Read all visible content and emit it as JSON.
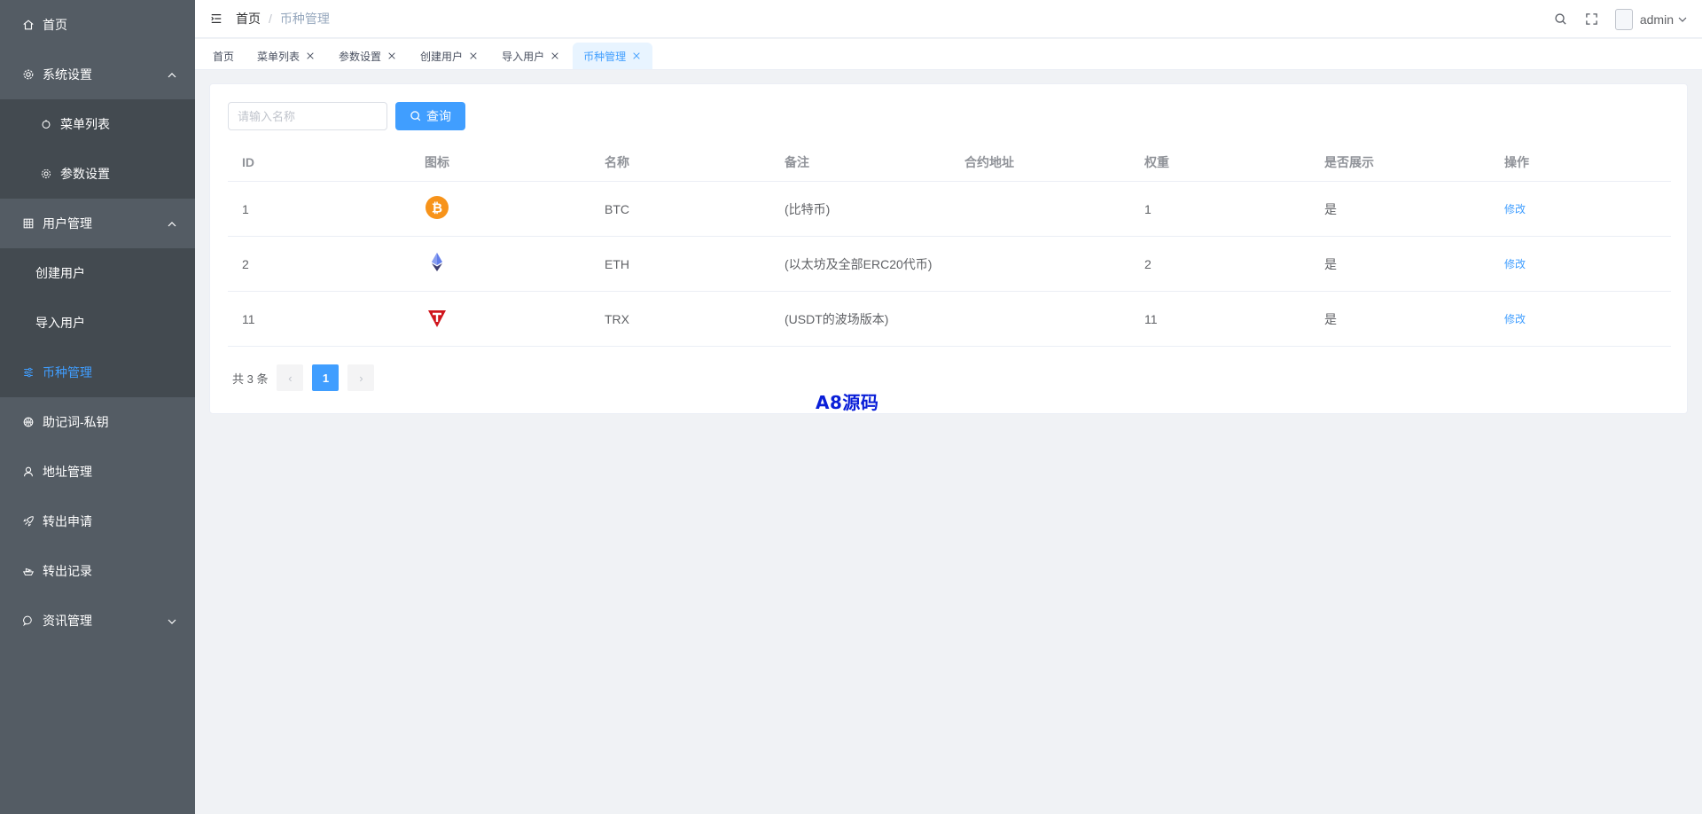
{
  "sidebar": {
    "items": [
      {
        "label": "首页",
        "icon": "home-icon"
      },
      {
        "label": "系统设置",
        "icon": "gear-icon"
      },
      {
        "label": "菜单列表",
        "icon": "menu-list-icon"
      },
      {
        "label": "参数设置",
        "icon": "settings-icon"
      },
      {
        "label": "用户管理",
        "icon": "user-manage-icon"
      },
      {
        "label": "创建用户"
      },
      {
        "label": "导入用户"
      },
      {
        "label": "币种管理",
        "icon": "sliders-icon",
        "active": true
      },
      {
        "label": "助记词-私钥",
        "icon": "basketball-icon"
      },
      {
        "label": "地址管理",
        "icon": "user-icon"
      },
      {
        "label": "转出申请",
        "icon": "rocket-icon"
      },
      {
        "label": "转出记录",
        "icon": "ship-icon"
      },
      {
        "label": "资讯管理",
        "icon": "chat-icon"
      }
    ]
  },
  "header": {
    "breadcrumb_home": "首页",
    "breadcrumb_sep": "/",
    "breadcrumb_current": "币种管理",
    "user_name": "admin"
  },
  "tags": [
    {
      "label": "首页",
      "closable": false
    },
    {
      "label": "菜单列表",
      "closable": true
    },
    {
      "label": "参数设置",
      "closable": true
    },
    {
      "label": "创建用户",
      "closable": true
    },
    {
      "label": "导入用户",
      "closable": true
    },
    {
      "label": "币种管理",
      "closable": true,
      "active": true
    }
  ],
  "search": {
    "placeholder": "请输入名称",
    "value": "",
    "button_label": "查询"
  },
  "table": {
    "headers": [
      "ID",
      "图标",
      "名称",
      "备注",
      "合约地址",
      "权重",
      "是否展示",
      "操作"
    ],
    "rows": [
      {
        "id": "1",
        "icon": "bitcoin-icon",
        "name": "BTC",
        "remark": "(比特币)",
        "contract": "",
        "weight": "1",
        "show": "是",
        "action": "修改"
      },
      {
        "id": "2",
        "icon": "ethereum-icon",
        "name": "ETH",
        "remark": "(以太坊及全部ERC20代币)",
        "contract": "",
        "weight": "2",
        "show": "是",
        "action": "修改"
      },
      {
        "id": "11",
        "icon": "tron-icon",
        "name": "TRX",
        "remark": "(USDT的波场版本)",
        "contract": "",
        "weight": "11",
        "show": "是",
        "action": "修改"
      }
    ]
  },
  "pagination": {
    "total_text": "共 3 条",
    "current_page": "1",
    "prev": "‹",
    "next": "›"
  },
  "watermark": "A8源码",
  "colors": {
    "sidebar_bg": "#545c64",
    "sidebar_sub_bg": "#434a50",
    "accent": "#409eff",
    "watermark": "#0a1fd8",
    "bitcoin": "#f7931a",
    "tron": "#d0161d",
    "ethereum": "#627eea"
  }
}
